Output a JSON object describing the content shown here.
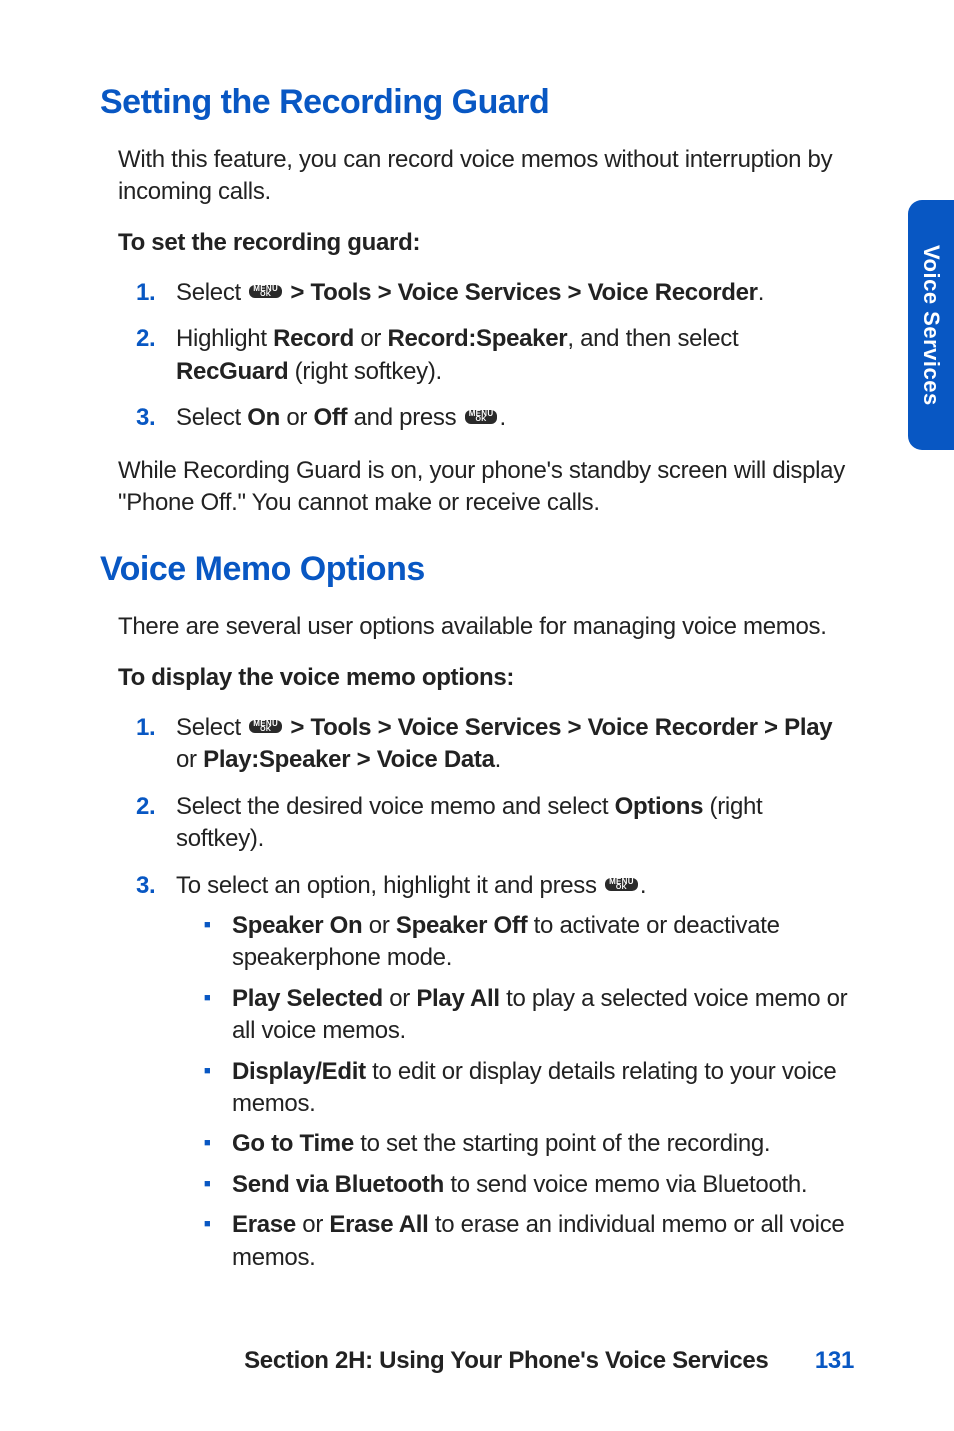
{
  "tab": {
    "label": "Voice Services"
  },
  "section1": {
    "heading": "Setting the Recording Guard",
    "intro": "With this feature, you can record voice memos without interruption by incoming calls.",
    "subhead": "To set the recording guard:",
    "steps": {
      "s1": {
        "pre": "Select ",
        "path": " > Tools > Voice Services > Voice Recorder",
        "post": "."
      },
      "s2": {
        "pre": "Highlight ",
        "b1": "Record",
        "mid1": " or ",
        "b2": "Record:Speaker",
        "mid2": ", and then select ",
        "b3": "RecGuard",
        "post": " (right softkey)."
      },
      "s3": {
        "pre": "Select ",
        "b1": "On",
        "mid1": " or ",
        "b2": "Off",
        "mid2": " and press ",
        "post": "."
      }
    },
    "note": "While Recording Guard is on, your phone's standby screen will display \"Phone Off.\"  You cannot make or receive calls."
  },
  "section2": {
    "heading": "Voice Memo Options",
    "intro": "There are several user options available for managing voice memos.",
    "subhead": "To display the voice memo options:",
    "steps": {
      "s1": {
        "pre": "Select ",
        "path": " > Tools > Voice Services > Voice Recorder > Play",
        "mid": " or ",
        "path2": "Play:Speaker > Voice Data",
        "post": "."
      },
      "s2": {
        "pre": "Select the desired voice memo and select ",
        "b1": "Options",
        "post": " (right softkey)."
      },
      "s3": {
        "pre": "To select an option, highlight it and press ",
        "post": "."
      }
    },
    "bullets": {
      "b1": {
        "bold1": "Speaker On",
        "mid": " or ",
        "bold2": "Speaker Off",
        "rest": " to activate or deactivate speakerphone mode."
      },
      "b2": {
        "bold1": "Play Selected",
        "mid": " or ",
        "bold2": "Play All",
        "rest": " to play a selected voice memo or all voice memos."
      },
      "b3": {
        "bold1": "Display/Edit",
        "rest": " to edit or display details relating to your voice memos."
      },
      "b4": {
        "bold1": "Go to Time",
        "rest": " to set the starting point of the recording."
      },
      "b5": {
        "bold1": "Send via Bluetooth",
        "rest": "  to send voice memo via Bluetooth."
      },
      "b6": {
        "bold1": "Erase",
        "mid": " or ",
        "bold2": "Erase All",
        "rest": " to erase an individual memo or all voice memos."
      }
    }
  },
  "footer": {
    "section": "Section 2H: Using Your Phone's Voice Services",
    "page": "131"
  },
  "icon": {
    "top": "MENU",
    "bottom": "OK"
  }
}
